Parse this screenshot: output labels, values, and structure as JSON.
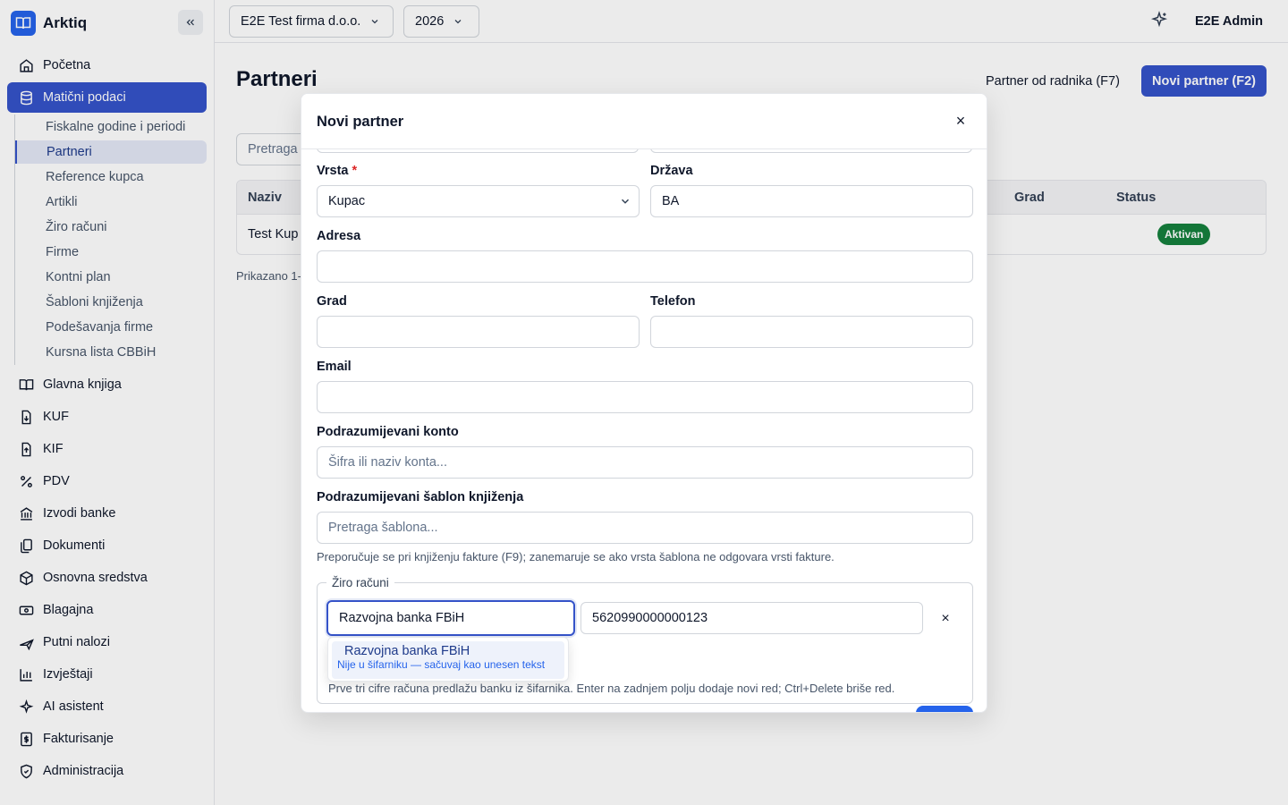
{
  "app": {
    "name": "Arktiq"
  },
  "sidebar": {
    "items": [
      {
        "label": "Početna",
        "icon": "home-icon"
      },
      {
        "label": "Matični podaci",
        "icon": "database-icon"
      },
      {
        "label": "Glavna knjiga",
        "icon": "book-icon"
      },
      {
        "label": "KUF",
        "icon": "file-in-icon"
      },
      {
        "label": "KIF",
        "icon": "file-out-icon"
      },
      {
        "label": "PDV",
        "icon": "percent-icon"
      },
      {
        "label": "Izvodi banke",
        "icon": "bank-icon"
      },
      {
        "label": "Dokumenti",
        "icon": "documents-icon"
      },
      {
        "label": "Osnovna sredstva",
        "icon": "box-icon"
      },
      {
        "label": "Blagajna",
        "icon": "cash-icon"
      },
      {
        "label": "Putni nalozi",
        "icon": "plane-icon"
      },
      {
        "label": "Izvještaji",
        "icon": "chart-icon"
      },
      {
        "label": "AI asistent",
        "icon": "sparkle-icon"
      },
      {
        "label": "Fakturisanje",
        "icon": "invoice-icon"
      },
      {
        "label": "Administracija",
        "icon": "shield-icon"
      }
    ],
    "subitems": [
      "Fiskalne godine i periodi",
      "Partneri",
      "Reference kupca",
      "Artikli",
      "Žiro računi",
      "Firme",
      "Kontni plan",
      "Šabloni knjiženja",
      "Podešavanja firme",
      "Kursna lista CBBiH"
    ]
  },
  "topbar": {
    "company": "E2E Test firma d.o.o.",
    "year": "2026",
    "user": "E2E Admin"
  },
  "page": {
    "title": "Partneri",
    "secondary_action": "Partner od radnika (F7)",
    "primary_action": "Novi partner (F2)",
    "search_placeholder": "Pretraga",
    "table": {
      "headers": [
        "Naziv",
        "Grad",
        "Status"
      ],
      "row": {
        "name": "Test Kup",
        "status": "Aktivan"
      }
    },
    "showing": "Prikazano 1-"
  },
  "modal": {
    "title": "Novi partner",
    "close": "×",
    "labels": {
      "vrsta": "Vrsta",
      "required_mark": "*",
      "drzava": "Država",
      "adresa": "Adresa",
      "grad": "Grad",
      "telefon": "Telefon",
      "email": "Email",
      "konto": "Podrazumijevani konto",
      "sablon": "Podrazumijevani šablon knjiženja"
    },
    "values": {
      "vrsta": "Kupac",
      "drzava": "BA",
      "adresa": "",
      "grad": "",
      "telefon": "",
      "email": ""
    },
    "placeholders": {
      "konto": "Šifra ili naziv konta...",
      "sablon": "Pretraga šablona..."
    },
    "sablon_hint": "Preporučuje se pri knjiženju fakture (F9); zanemaruje se ako vrsta šablona ne odgovara vrsti fakture.",
    "ziro": {
      "legend": "Žiro računi",
      "bank_value": "Razvojna banka FBiH",
      "account_value": "5620990000000123",
      "remove": "×",
      "suggestion_title": "Razvojna banka FBiH",
      "suggestion_sub": "Nije u šifarniku — sačuvaj kao unesen tekst",
      "hint": "Prve tri cifre računa predlažu banku iz šifarnika. Enter na zadnjem polju dodaje novi red; Ctrl+Delete briše red."
    }
  },
  "colors": {
    "accent": "#3553c9",
    "status_active": "#15803d"
  }
}
